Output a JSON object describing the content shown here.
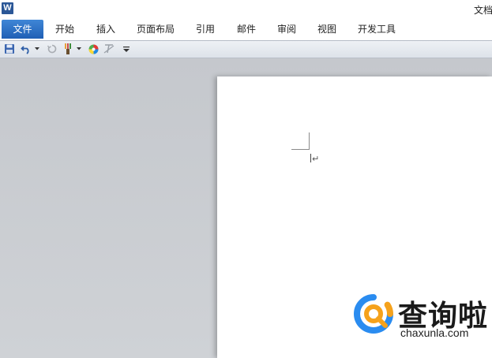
{
  "window": {
    "app_icon_letter": "W",
    "title": "文档"
  },
  "ribbon": {
    "file_tab": "文件",
    "tabs": [
      {
        "label": "开始"
      },
      {
        "label": "插入"
      },
      {
        "label": "页面布局"
      },
      {
        "label": "引用"
      },
      {
        "label": "邮件"
      },
      {
        "label": "审阅"
      },
      {
        "label": "视图"
      },
      {
        "label": "开发工具"
      }
    ]
  },
  "quick_access": {
    "icons": [
      "save-icon",
      "undo-icon",
      "redo-icon",
      "format-painter-icon",
      "color-wheel-icon",
      "clear-format-icon",
      "customize-dropdown-icon"
    ]
  },
  "document": {
    "paragraph_mark": "↵"
  },
  "watermark": {
    "cn": "查询啦",
    "en": "chaxunla.com",
    "colors": {
      "ring_blue": "#2a8cf0",
      "ring_orange": "#f5a21c"
    }
  }
}
